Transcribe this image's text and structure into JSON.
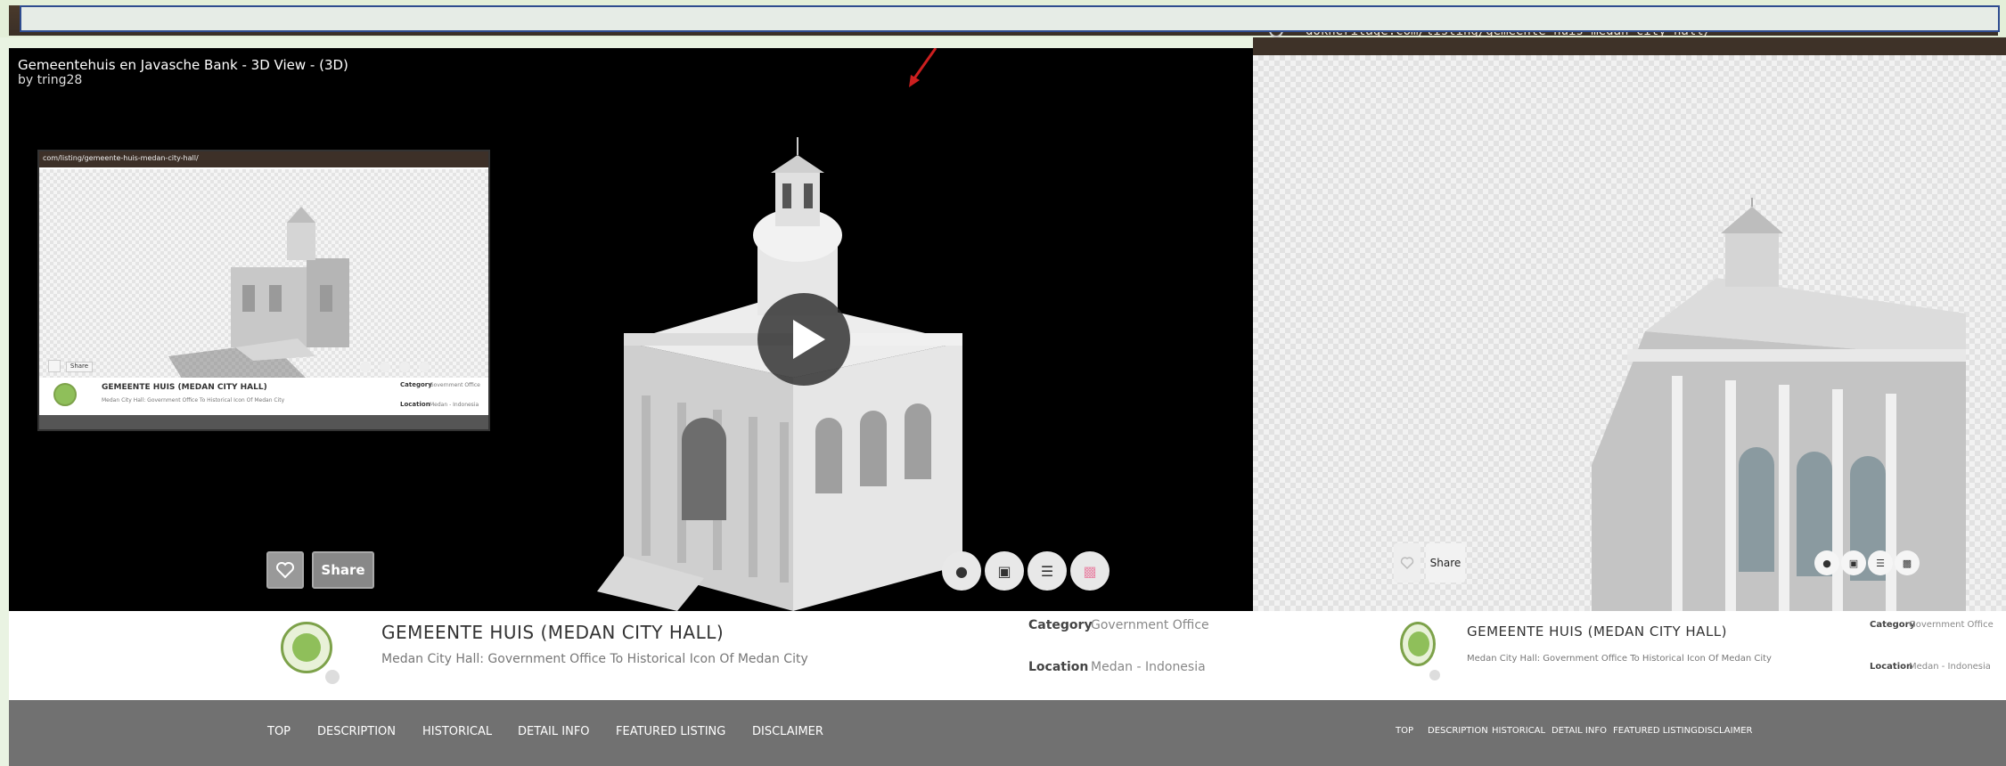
{
  "browser": {
    "url_text": "dokheritage.com/listing/gemeente-huis-medan-city-hall/"
  },
  "viewer": {
    "title": "Gemeentehuis en Javasche Bank - 3D View - (3D)",
    "author": "by tring28",
    "share_label": "Share",
    "tools": [
      "camera-icon",
      "gallery-icon",
      "map-icon",
      "embed-icon"
    ]
  },
  "thumbnail": {
    "url_text": "com/listing/gemeente-huis-medan-city-hall/",
    "share_label": "Share",
    "title": "GEMEENTE HUIS (MEDAN CITY HALL)",
    "subtitle": "Medan City Hall: Government Office To Historical Icon Of Medan City",
    "category_label": "Category",
    "category_value": "Government Office",
    "location_label": "Location",
    "location_value": "Medan - Indonesia"
  },
  "listing": {
    "title": "GEMEENTE HUIS (MEDAN CITY HALL)",
    "subtitle": "Medan City Hall: Government Office To Historical Icon Of Medan City",
    "category_label": "Category",
    "category_value": "Government Office",
    "location_label": "Location",
    "location_value": "Medan - Indonesia"
  },
  "nav": [
    "TOP",
    "DESCRIPTION",
    "HISTORICAL",
    "DETAIL INFO",
    "FEATURED LISTING",
    "DISCLAIMER"
  ],
  "right_viewer": {
    "share_label": "Share"
  },
  "colors": {
    "accent_arrow": "#cc1f1f",
    "nav_bg": "#717171",
    "logo_green": "#7da24a"
  }
}
